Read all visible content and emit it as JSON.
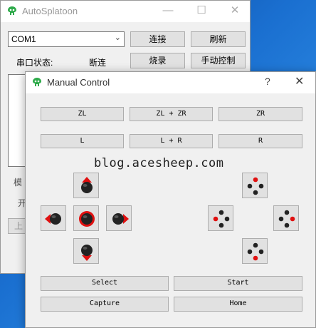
{
  "main_window": {
    "title": "AutoSplatoon",
    "minimize": "—",
    "maximize": "☐",
    "close": "✕",
    "port_select": {
      "value": "COM1",
      "arrow": "⌄"
    },
    "connect_label": "连接",
    "refresh_label": "刷新",
    "serial_status_label": "串口状态:",
    "serial_status_value": "断连",
    "burn_label": "烧录",
    "manual_control_label": "手动控制",
    "partial_left_1": "模",
    "partial_left_2": "开",
    "partial_left_3": "上"
  },
  "manual_dialog": {
    "title": "Manual Control",
    "help": "?",
    "close": "✕",
    "triggers": {
      "zl": "ZL",
      "zl_zr": "ZL + ZR",
      "zr": "ZR",
      "l": "L",
      "l_r": "L + R",
      "r": "R"
    },
    "select_label": "Select",
    "start_label": "Start",
    "capture_label": "Capture",
    "home_label": "Home"
  },
  "watermark": "blog.acesheep.com",
  "colors": {
    "accent_red": "#e01010",
    "stick_dark": "#202020",
    "face_dot": "#222222",
    "icon_green": "#2eaa4a"
  }
}
